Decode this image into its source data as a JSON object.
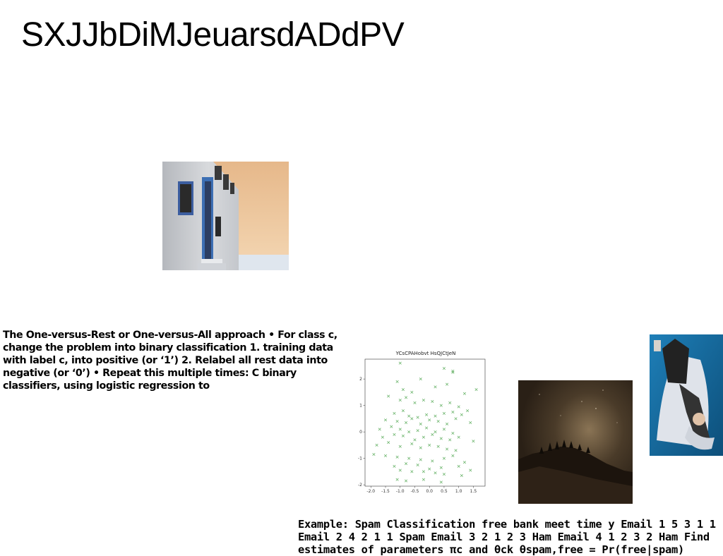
{
  "slide": {
    "title": "SXJJbDiMJeuarsdADdPV",
    "body_text": "The One-versus-Rest or One-versus-All approach • For class c, change the problem into binary classification 1. training data with label c, into positive (or ‘1’) 2. Relabel all rest data into negative (or ‘0’) • Repeat this multiple times: C binary classifiers, using logistic regression to",
    "example_text": "Example: Spam Classification free bank meet time y Email 1 5 3 1 1 Email 2 4 2 1 1 Spam Email 3 2 1 2 3 Ham Email 4 1 2 3 2 Ham Find estimates of parameters πc and θck θspam,free = Pr(free|spam)"
  },
  "images": {
    "building": "white-building-photo",
    "night_sky": "night-sky-photo",
    "person": "person-on-chair-photo"
  },
  "chart_data": {
    "type": "scatter",
    "title": "YCsCPAHobvt HsQJCtJeN",
    "xlabel": "",
    "ylabel": "",
    "xlim": [
      -2.2,
      1.9
    ],
    "ylim": [
      -2.05,
      2.75
    ],
    "xticks": [
      -2.0,
      -1.5,
      -1.0,
      -0.5,
      0.0,
      0.5,
      1.0,
      1.5
    ],
    "xtick_labels": [
      "-2.0",
      "-1.5",
      "-1.0",
      "-0.5",
      "0.0",
      "0.5",
      "1.0",
      "1.5"
    ],
    "yticks": [
      -2,
      -1,
      0,
      1,
      2
    ],
    "ytick_labels": [
      "-2",
      "-1",
      "0",
      "1",
      "2"
    ],
    "marker": "x",
    "grid": false,
    "color": "#5fae5f",
    "series": [
      {
        "x": [
          -1.0,
          0.5,
          0.8,
          0.8,
          -1.1,
          -0.9,
          -0.6,
          -0.3,
          0.2,
          0.6,
          1.2,
          1.6,
          -1.4,
          -1.0,
          -0.8,
          -0.5,
          -0.2,
          0.1,
          0.4,
          0.7,
          1.0,
          1.3,
          -1.2,
          -0.9,
          -0.7,
          -0.4,
          -0.1,
          0.2,
          0.5,
          0.8,
          1.1,
          -1.5,
          -1.1,
          -0.8,
          -0.6,
          -0.3,
          0.0,
          0.3,
          0.6,
          0.9,
          1.4,
          -1.7,
          -1.3,
          -1.0,
          -0.7,
          -0.4,
          -0.1,
          0.2,
          0.5,
          0.8,
          -1.6,
          -1.2,
          -0.9,
          -0.5,
          -0.2,
          0.1,
          0.4,
          0.7,
          1.0,
          1.5,
          -1.8,
          -1.4,
          -1.0,
          -0.6,
          -0.3,
          0.0,
          0.3,
          0.6,
          0.9,
          -1.9,
          -1.5,
          -1.1,
          -0.7,
          -0.3,
          0.1,
          0.5,
          0.8,
          1.2,
          -1.2,
          -0.8,
          -0.4,
          0.0,
          0.4,
          1.0,
          1.4,
          -1.0,
          -0.6,
          -0.2,
          0.2,
          0.5,
          1.1,
          -1.1,
          -0.8,
          -0.2,
          0.4
        ],
        "y": [
          2.6,
          2.4,
          2.3,
          2.25,
          1.9,
          1.6,
          1.5,
          2.0,
          1.7,
          1.8,
          1.45,
          1.6,
          1.35,
          1.2,
          1.3,
          1.1,
          1.2,
          1.15,
          1.0,
          1.1,
          0.95,
          0.8,
          0.7,
          0.8,
          0.6,
          0.55,
          0.65,
          0.6,
          0.7,
          0.75,
          0.65,
          0.45,
          0.4,
          0.35,
          0.5,
          0.3,
          0.45,
          0.4,
          0.3,
          0.5,
          0.35,
          0.1,
          0.2,
          0.1,
          0.0,
          0.05,
          0.15,
          0.0,
          0.1,
          -0.05,
          -0.2,
          -0.1,
          -0.15,
          -0.3,
          -0.2,
          -0.1,
          -0.25,
          -0.3,
          -0.2,
          -0.35,
          -0.5,
          -0.4,
          -0.55,
          -0.45,
          -0.6,
          -0.5,
          -0.55,
          -0.65,
          -0.7,
          -0.85,
          -0.9,
          -0.95,
          -1.0,
          -1.05,
          -1.1,
          -1.0,
          -0.9,
          -1.15,
          -1.3,
          -1.2,
          -1.25,
          -1.4,
          -1.35,
          -1.3,
          -1.45,
          -1.45,
          -1.5,
          -1.5,
          -1.55,
          -1.6,
          -1.65,
          -1.8,
          -1.85,
          -1.8,
          -1.9
        ]
      }
    ]
  }
}
